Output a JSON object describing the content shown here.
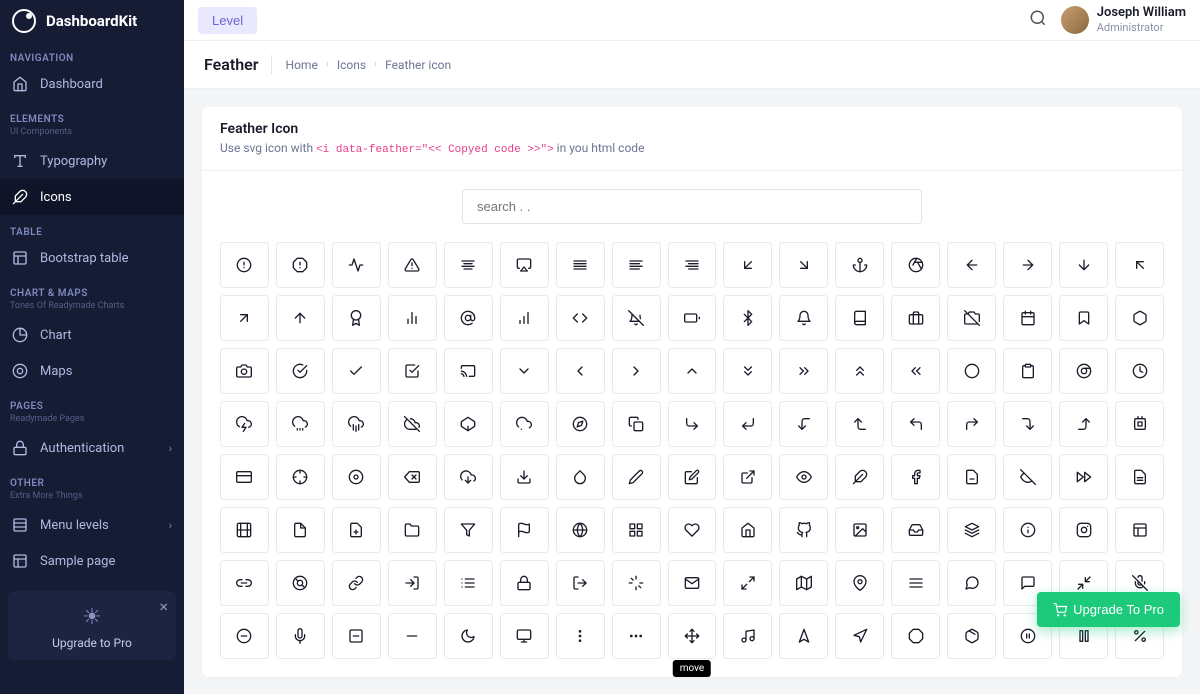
{
  "brand": "DashboardKit",
  "topbar": {
    "level_btn": "Level",
    "user_name": "Joseph William",
    "user_role": "Administrator"
  },
  "page": {
    "title": "Feather"
  },
  "breadcrumb": [
    "Home",
    "Icons",
    "Feather icon"
  ],
  "card": {
    "title": "Feather Icon",
    "desc_pre": "Use svg icon with ",
    "desc_code": "<i data-feather=\"<< Copyed code >>\">",
    "desc_post": " in you html code",
    "search_placeholder": "search . ."
  },
  "sidebar": {
    "sections": [
      {
        "caption": "NAVIGATION",
        "items": [
          {
            "label": "Dashboard",
            "icon": "home"
          }
        ]
      },
      {
        "caption": "ELEMENTS",
        "sub": "UI Components",
        "items": [
          {
            "label": "Typography",
            "icon": "type"
          },
          {
            "label": "Icons",
            "icon": "feather",
            "active": true
          }
        ]
      },
      {
        "caption": "TABLE",
        "items": [
          {
            "label": "Bootstrap table",
            "icon": "table"
          }
        ]
      },
      {
        "caption": "CHART & MAPS",
        "sub": "Tones Of Readymade Charts",
        "items": [
          {
            "label": "Chart",
            "icon": "chart"
          },
          {
            "label": "Maps",
            "icon": "map"
          }
        ]
      },
      {
        "caption": "PAGES",
        "sub": "Readymade Pages",
        "items": [
          {
            "label": "Authentication",
            "icon": "lock",
            "arrow": true
          }
        ]
      },
      {
        "caption": "OTHER",
        "sub": "Extra More Things",
        "items": [
          {
            "label": "Menu levels",
            "icon": "menu",
            "arrow": true
          },
          {
            "label": "Sample page",
            "icon": "page"
          }
        ]
      }
    ],
    "upgrade": {
      "title": "Upgrade to Pro"
    }
  },
  "icons": [
    "alert-circle",
    "alert-octagon",
    "activity",
    "alert-triangle",
    "align-center",
    "airplay",
    "align-justify",
    "align-left",
    "align-right",
    "arrow-down-left",
    "arrow-down-right",
    "anchor",
    "aperture",
    "arrow-left",
    "arrow-right",
    "arrow-down",
    "arrow-up-left",
    "arrow-up-right",
    "arrow-up",
    "award",
    "bar-chart-2",
    "at-sign",
    "bar-chart",
    "code-snippet",
    "bell-off",
    "battery",
    "bluetooth",
    "bell",
    "book",
    "briefcase",
    "camera-off",
    "calendar",
    "bookmark",
    "box",
    "camera",
    "check-circle",
    "check",
    "check-square",
    "cast",
    "chevron-down",
    "chevron-left",
    "chevron-right",
    "chevron-up",
    "chevrons-down",
    "chevrons-right",
    "chevrons-up",
    "chevrons-left",
    "circle",
    "clipboard",
    "chrome",
    "clock",
    "cloud-lightning",
    "cloud-drizzle",
    "cloud-rain",
    "cloud-off",
    "codepen",
    "cloud-snow",
    "compass",
    "copy",
    "corner-down-right",
    "corner-down-left",
    "corner-left-down",
    "corner-left-up",
    "corner-up-left",
    "corner-up-right",
    "corner-right-down",
    "corner-right-up",
    "cpu",
    "credit-card",
    "crosshair",
    "disc",
    "delete",
    "download-cloud",
    "download",
    "droplet",
    "edit-2",
    "edit",
    "external-link",
    "eye",
    "feather",
    "facebook",
    "file-minus",
    "eye-off",
    "fast-forward",
    "file-text",
    "film",
    "file",
    "file-plus",
    "folder",
    "filter",
    "flag",
    "globe",
    "grid",
    "heart",
    "home",
    "github",
    "image",
    "inbox",
    "layers",
    "info",
    "instagram",
    "layout",
    "link-2",
    "life-buoy",
    "link",
    "log-in",
    "list",
    "lock",
    "log-out",
    "loader",
    "mail",
    "maximize-2",
    "map",
    "map-pin",
    "menu",
    "message-circle",
    "message-square",
    "minimize-2",
    "mic-off",
    "minus-circle",
    "mic",
    "minus-square",
    "minus",
    "moon",
    "monitor",
    "more-vertical",
    "more-horizontal",
    "move",
    "music",
    "navigation-2",
    "navigation",
    "octagon",
    "package",
    "pause-circle",
    "pause",
    "percent"
  ],
  "tooltip": {
    "index": 127,
    "label": "move"
  },
  "fab": {
    "label": "Upgrade To Pro"
  }
}
